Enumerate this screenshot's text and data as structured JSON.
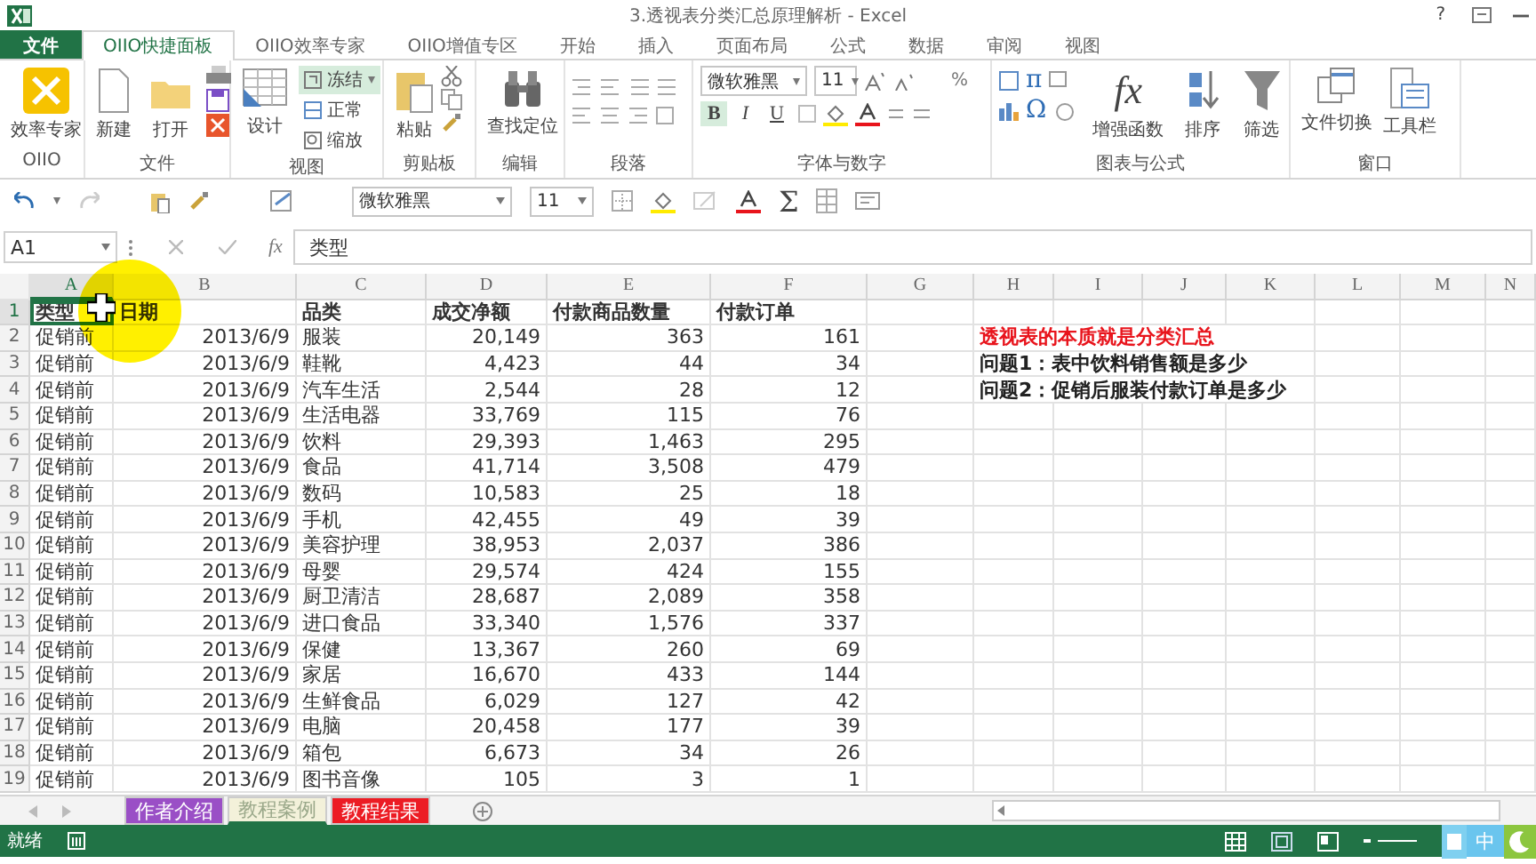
{
  "window": {
    "title": "3.透视表分类汇总原理解析 - Excel",
    "help": "?"
  },
  "tabs": [
    {
      "label": "文件",
      "kind": "file",
      "selected": false
    },
    {
      "label": "OIIO快捷面板",
      "kind": "tab",
      "selected": true
    },
    {
      "label": "OIIO效率专家",
      "kind": "tab",
      "selected": false
    },
    {
      "label": "OIIO增值专区",
      "kind": "tab",
      "selected": false
    },
    {
      "label": "开始",
      "kind": "tab",
      "selected": false
    },
    {
      "label": "插入",
      "kind": "tab",
      "selected": false
    },
    {
      "label": "页面布局",
      "kind": "tab",
      "selected": false
    },
    {
      "label": "公式",
      "kind": "tab",
      "selected": false
    },
    {
      "label": "数据",
      "kind": "tab",
      "selected": false
    },
    {
      "label": "审阅",
      "kind": "tab",
      "selected": false
    },
    {
      "label": "视图",
      "kind": "tab",
      "selected": false
    }
  ],
  "ribbon": {
    "groups": [
      {
        "label": "OIIO",
        "buttons": [
          {
            "label": "效率专家"
          }
        ]
      },
      {
        "label": "文件",
        "buttons": [
          {
            "label": "新建"
          },
          {
            "label": "打开"
          }
        ]
      },
      {
        "label": "视图",
        "buttons": [
          {
            "label": "设计"
          },
          {
            "label": "冻结",
            "selected": true
          },
          {
            "label": "正常",
            "selected": false
          },
          {
            "label": "缩放",
            "selected": false
          }
        ]
      },
      {
        "label": "剪贴板",
        "buttons": [
          {
            "label": "粘贴"
          }
        ]
      },
      {
        "label": "编辑",
        "buttons": [
          {
            "label": "查找定位"
          }
        ]
      },
      {
        "label": "段落"
      },
      {
        "label": "字体与数字",
        "font": "微软雅黑",
        "size": "11",
        "buttons": [
          {
            "label": "B",
            "selected": true
          },
          {
            "label": "I",
            "selected": false
          },
          {
            "label": "U",
            "selected": false
          }
        ],
        "percent": "%"
      },
      {
        "label": "图表与公式",
        "symbols": [
          "π",
          "Ω"
        ],
        "fx": "fx",
        "buttons": [
          {
            "label": "增强函数"
          },
          {
            "label": "排序"
          },
          {
            "label": "筛选"
          }
        ]
      },
      {
        "label": "窗口",
        "buttons": [
          {
            "label": "文件切换"
          },
          {
            "label": "工具栏"
          }
        ]
      }
    ]
  },
  "quick_toolbar": {
    "font": "微软雅黑",
    "size": "11",
    "sum": "Σ"
  },
  "formula_bar": {
    "name_box": "A1",
    "fx": "fx",
    "formula": "类型"
  },
  "sheet": {
    "columns": [
      {
        "label": "A",
        "selected": true
      },
      {
        "label": "B",
        "selected": false
      },
      {
        "label": "C",
        "selected": false
      },
      {
        "label": "D",
        "selected": false
      },
      {
        "label": "E",
        "selected": false
      },
      {
        "label": "F",
        "selected": false
      },
      {
        "label": "G",
        "selected": false
      },
      {
        "label": "H",
        "selected": false
      },
      {
        "label": "I",
        "selected": false
      },
      {
        "label": "J",
        "selected": false
      },
      {
        "label": "K",
        "selected": false
      },
      {
        "label": "L",
        "selected": false
      },
      {
        "label": "M",
        "selected": false
      },
      {
        "label": "N",
        "selected": false
      }
    ],
    "rows": [
      {
        "number": "1",
        "selected": true,
        "header": true,
        "cells": [
          "类型",
          "日期",
          "品类",
          "成交净额",
          "付款商品数量",
          "付款订单"
        ]
      },
      {
        "number": "2",
        "selected": false,
        "cells": [
          "促销前",
          "2013/6/9",
          "服装",
          "20,149",
          "363",
          "161"
        ],
        "note": {
          "text": "透视表的本质就是分类汇总",
          "emphasis": true
        }
      },
      {
        "number": "3",
        "selected": false,
        "cells": [
          "促销前",
          "2013/6/9",
          "鞋靴",
          "4,423",
          "44",
          "34"
        ],
        "note": {
          "text": "问题1：表中饮料销售额是多少",
          "emphasis": false
        }
      },
      {
        "number": "4",
        "selected": false,
        "cells": [
          "促销前",
          "2013/6/9",
          "汽车生活",
          "2,544",
          "28",
          "12"
        ],
        "note": {
          "text": "问题2：促销后服装付款订单是多少",
          "emphasis": false
        }
      },
      {
        "number": "5",
        "selected": false,
        "cells": [
          "促销前",
          "2013/6/9",
          "生活电器",
          "33,769",
          "115",
          "76"
        ]
      },
      {
        "number": "6",
        "selected": false,
        "cells": [
          "促销前",
          "2013/6/9",
          "饮料",
          "29,393",
          "1,463",
          "295"
        ]
      },
      {
        "number": "7",
        "selected": false,
        "cells": [
          "促销前",
          "2013/6/9",
          "食品",
          "41,714",
          "3,508",
          "479"
        ]
      },
      {
        "number": "8",
        "selected": false,
        "cells": [
          "促销前",
          "2013/6/9",
          "数码",
          "10,583",
          "25",
          "18"
        ]
      },
      {
        "number": "9",
        "selected": false,
        "cells": [
          "促销前",
          "2013/6/9",
          "手机",
          "42,455",
          "49",
          "39"
        ]
      },
      {
        "number": "10",
        "selected": false,
        "cells": [
          "促销前",
          "2013/6/9",
          "美容护理",
          "38,953",
          "2,037",
          "386"
        ]
      },
      {
        "number": "11",
        "selected": false,
        "cells": [
          "促销前",
          "2013/6/9",
          "母婴",
          "29,574",
          "424",
          "155"
        ]
      },
      {
        "number": "12",
        "selected": false,
        "cells": [
          "促销前",
          "2013/6/9",
          "厨卫清洁",
          "28,687",
          "2,089",
          "358"
        ]
      },
      {
        "number": "13",
        "selected": false,
        "cells": [
          "促销前",
          "2013/6/9",
          "进口食品",
          "33,340",
          "1,576",
          "337"
        ]
      },
      {
        "number": "14",
        "selected": false,
        "cells": [
          "促销前",
          "2013/6/9",
          "保健",
          "13,367",
          "260",
          "69"
        ]
      },
      {
        "number": "15",
        "selected": false,
        "cells": [
          "促销前",
          "2013/6/9",
          "家居",
          "16,670",
          "433",
          "144"
        ]
      },
      {
        "number": "16",
        "selected": false,
        "cells": [
          "促销前",
          "2013/6/9",
          "生鲜食品",
          "6,029",
          "127",
          "42"
        ]
      },
      {
        "number": "17",
        "selected": false,
        "cells": [
          "促销前",
          "2013/6/9",
          "电脑",
          "20,458",
          "177",
          "39"
        ]
      },
      {
        "number": "18",
        "selected": false,
        "cells": [
          "促销前",
          "2013/6/9",
          "箱包",
          "6,673",
          "34",
          "26"
        ]
      },
      {
        "number": "19",
        "selected": false,
        "cells": [
          "促销前",
          "2013/6/9",
          "图书音像",
          "105",
          "3",
          "1"
        ]
      }
    ]
  },
  "sheet_tabs": [
    {
      "label": "作者介绍",
      "selected": false,
      "color": "#9a4fc6"
    },
    {
      "label": "教程案例",
      "selected": true,
      "color": "#f3f1da"
    },
    {
      "label": "教程结果",
      "selected": false,
      "color": "#ec1c24"
    }
  ],
  "status_bar": {
    "text": "就绪",
    "ime": "中"
  }
}
